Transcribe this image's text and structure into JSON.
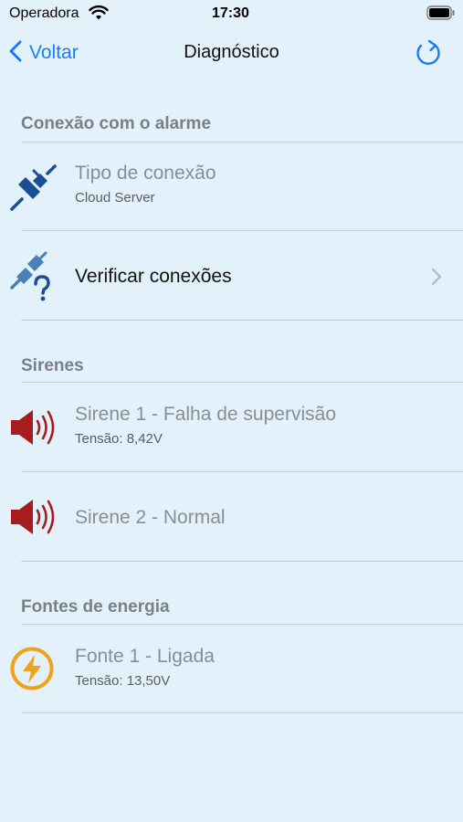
{
  "status_bar": {
    "carrier": "Operadora",
    "time": "17:30"
  },
  "nav": {
    "back_label": "Voltar",
    "title": "Diagnóstico"
  },
  "sections": {
    "connection": {
      "header": "Conexão com o alarme",
      "type_title": "Tipo de conexão",
      "type_value": "Cloud Server",
      "verify_title": "Verificar conexões"
    },
    "sirens": {
      "header": "Sirenes",
      "siren1_title": "Sirene 1 - Falha de supervisão",
      "siren1_sub": "Tensão: 8,42V",
      "siren2_title": "Sirene 2 - Normal"
    },
    "power": {
      "header": "Fontes de energia",
      "source1_title": "Fonte 1 - Ligada",
      "source1_sub": "Tensão: 13,50V"
    }
  },
  "colors": {
    "background": "#e3f1fb",
    "accent": "#1a7ef3",
    "plug_icon": "#1b4f94",
    "siren_icon": "#a51d1d",
    "power_icon": "#f0a21a"
  },
  "icons": [
    "wifi-icon",
    "battery-icon",
    "chevron-left-icon",
    "refresh-icon",
    "plug-icon",
    "plug-question-icon",
    "chevron-right-icon",
    "speaker-icon",
    "lightning-icon"
  ]
}
